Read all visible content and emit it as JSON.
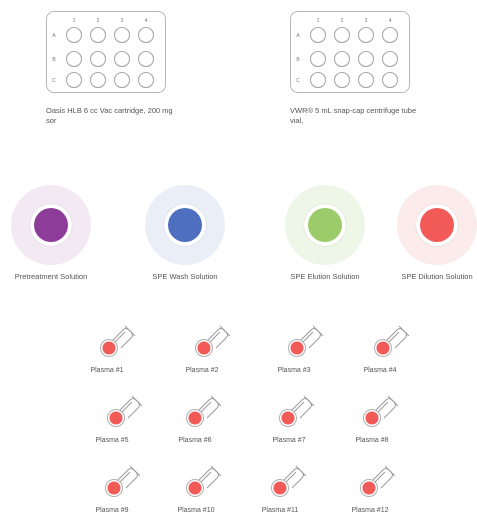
{
  "racks": [
    {
      "caption": "Oasis HLB 6 cc Vac cartridge, 200 mg\nsor",
      "columns": [
        "1",
        "2",
        "3",
        "4"
      ],
      "rows": [
        "A",
        "B",
        "C"
      ]
    },
    {
      "caption": "VWR® 5 mL snap-cap centrifuge tube\nvial,",
      "columns": [
        "1",
        "2",
        "3",
        "4"
      ],
      "rows": [
        "A",
        "B",
        "C"
      ]
    }
  ],
  "reagents": [
    {
      "label": "Pretreatment Solution",
      "color": "#8e3c9a",
      "halo": "#f2e9f3"
    },
    {
      "label": "SPE Wash Solution",
      "color": "#4e6fc0",
      "halo": "#e9eef7"
    },
    {
      "label": "SPE Elution Solution",
      "color": "#9ccc6a",
      "halo": "#eef6e8"
    },
    {
      "label": "SPE Dilution Solution",
      "color": "#f25a58",
      "halo": "#fbebeb"
    }
  ],
  "samples": [
    {
      "label": "Plasma #1"
    },
    {
      "label": "Plasma #2"
    },
    {
      "label": "Plasma #3"
    },
    {
      "label": "Plasma #4"
    },
    {
      "label": "Plasma #5"
    },
    {
      "label": "Plasma #6"
    },
    {
      "label": "Plasma #7"
    },
    {
      "label": "Plasma #8"
    },
    {
      "label": "Plasma #9"
    },
    {
      "label": "Plasma #10"
    },
    {
      "label": "Plasma #11"
    },
    {
      "label": "Plasma #12"
    }
  ],
  "sample_color": "#f25a58",
  "icons": {
    "rack": "well-plate-icon",
    "reagent": "reagent-reservoir-icon",
    "sample": "sample-tube-icon"
  }
}
